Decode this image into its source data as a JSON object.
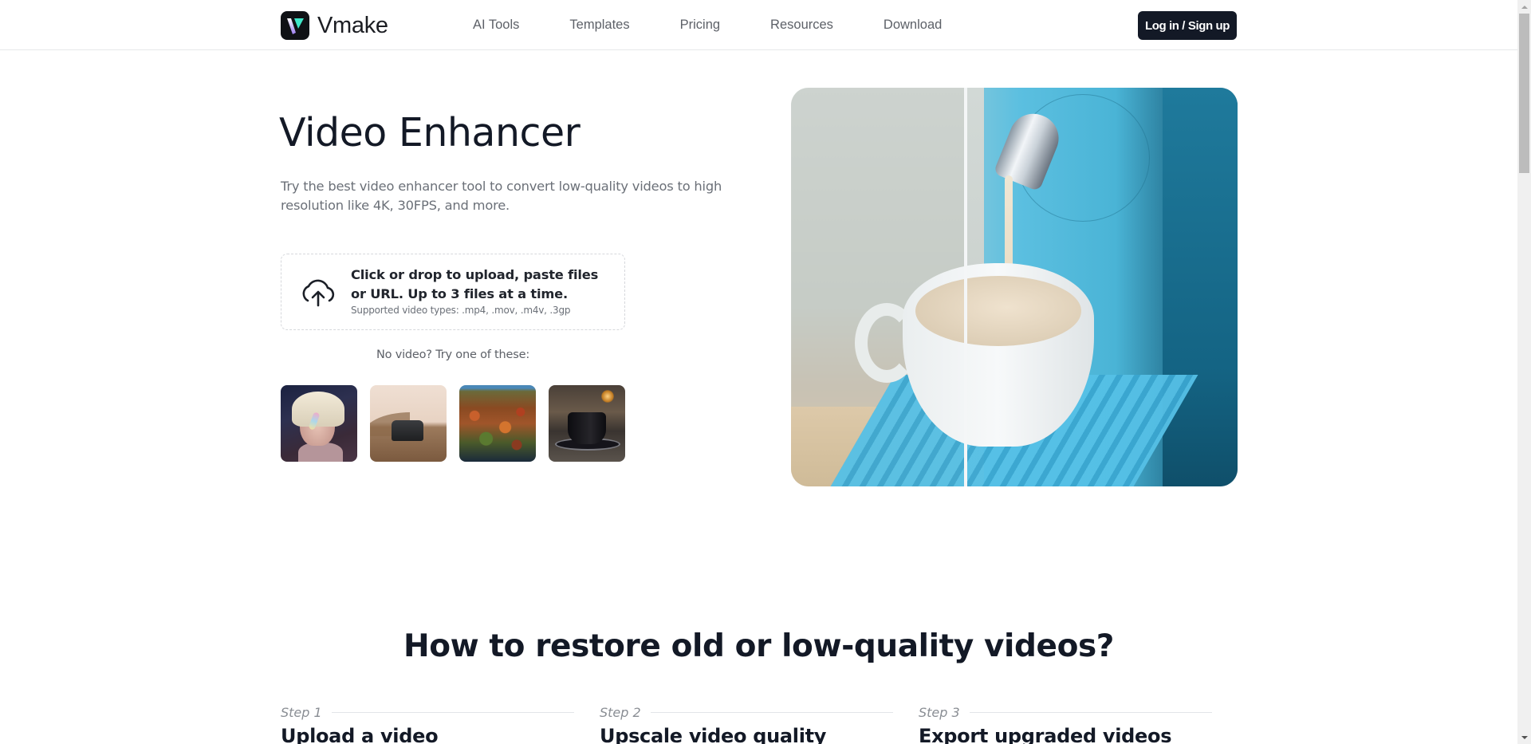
{
  "header": {
    "brand": "Vmake",
    "nav": [
      {
        "label": "AI Tools"
      },
      {
        "label": "Templates"
      },
      {
        "label": "Pricing"
      },
      {
        "label": "Resources"
      },
      {
        "label": "Download"
      }
    ],
    "login_label": "Log in / Sign up"
  },
  "hero": {
    "title": "Video Enhancer",
    "description": "Try the best video enhancer tool to convert low-quality videos to high resolution like 4K, 30FPS, and more.",
    "upload": {
      "icon": "cloud-upload-icon",
      "main_text": "Click or drop to upload, paste files or URL. Up to 3 files at a time.",
      "supported_text": "Supported video types: .mp4, .mov, .m4v, .3gp"
    },
    "try_label": "No video? Try one of these:",
    "samples": [
      {
        "name": "sample-portrait"
      },
      {
        "name": "sample-desert-car"
      },
      {
        "name": "sample-autumn-forest"
      },
      {
        "name": "sample-coffee-cup"
      }
    ],
    "preview": {
      "subject": "before-after comparison of coffee machine pouring milk into cup"
    }
  },
  "howto": {
    "title": "How to restore old or low-quality videos?",
    "steps": [
      {
        "label": "Step 1",
        "title": "Upload a video"
      },
      {
        "label": "Step 2",
        "title": "Upscale video quality"
      },
      {
        "label": "Step 3",
        "title": "Export upgraded videos"
      }
    ]
  },
  "colors": {
    "primary_dark": "#131926",
    "logo_accent": "#3ee6c8",
    "text_muted": "#6b7078",
    "border": "#e7e8ea"
  }
}
